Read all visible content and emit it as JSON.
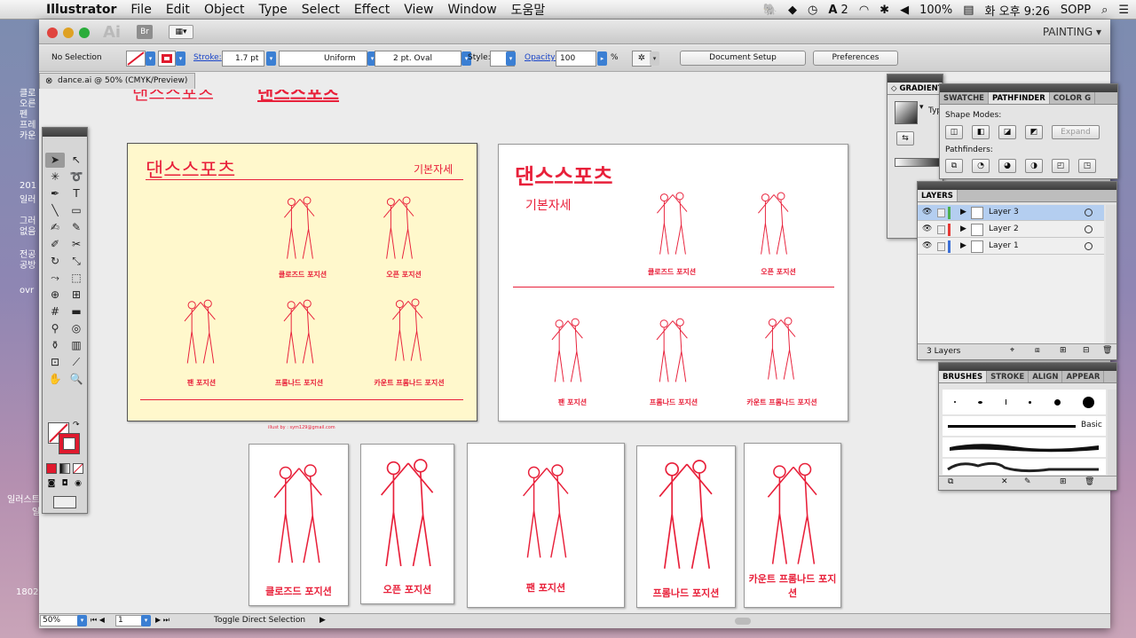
{
  "menubar": {
    "app": "Illustrator",
    "items": [
      "File",
      "Edit",
      "Object",
      "Type",
      "Select",
      "Effect",
      "View",
      "Window",
      "도움말"
    ],
    "right": {
      "ai_badge": "2",
      "battery": "100%",
      "clock": "화 오후 9:26",
      "user": "SOPP"
    }
  },
  "desktop_labels": [
    "클로",
    "오른",
    "펜",
    "프레",
    "카운",
    "201",
    "일러",
    "그러",
    "없음",
    "전공",
    "공방",
    "ovr",
    "일러스트",
    "일",
    "1802"
  ],
  "window": {
    "logo": "Ai",
    "bridge": "Br",
    "workspace": "PAINTING",
    "control": {
      "selection": "No Selection",
      "stroke_label": "Stroke:",
      "stroke_value": "1.7 pt",
      "profile": "Uniform",
      "brush": "2 pt. Oval",
      "style_label": "Style:",
      "opacity_label": "Opacity:",
      "opacity_value": "100",
      "opacity_unit": "%",
      "doc_setup": "Document Setup",
      "preferences": "Preferences"
    },
    "doc_tab": "dance.ai @ 50% (CMYK/Preview)"
  },
  "artwork": {
    "top_partial_left": "댄스스포츠",
    "top_partial_right": "댄스스포츠",
    "board1": {
      "title": "댄스스포츠",
      "subtitle": "기본자세",
      "captions": [
        "클로즈드 포지션",
        "오픈 포지션",
        "팬 포지션",
        "프롬나드 포지션",
        "카운트 프롬나드 포지션"
      ],
      "credit": "illust by : sym129@gmail.com"
    },
    "board2": {
      "title": "댄스스포츠",
      "subtitle": "기본자세",
      "captions": [
        "클로즈드 포지션",
        "오픈 포지션",
        "팬 포지션",
        "프롬나드 포지션",
        "카운트 프롬나드 포지션"
      ]
    },
    "cards": [
      "클로즈드 포지션",
      "오픈 포지션",
      "팬 포지션",
      "프롬나드 포지션",
      "카운트 프롬나드 포지션"
    ]
  },
  "status": {
    "zoom": "50%",
    "page": "1",
    "tool_hint": "Toggle Direct Selection"
  },
  "gradient_panel": {
    "tab": "GRADIENT",
    "type_label": "Typ"
  },
  "pathfinder_panel": {
    "tabs": [
      "SWATCHE",
      "PATHFINDER",
      "COLOR G"
    ],
    "shape_modes": "Shape Modes:",
    "pathfinders": "Pathfinders:",
    "expand": "Expand"
  },
  "layers_panel": {
    "tab": "LAYERS",
    "layers": [
      {
        "name": "Layer 3",
        "color": "#4caf50",
        "selected": true
      },
      {
        "name": "Layer 2",
        "color": "#e53935",
        "selected": false
      },
      {
        "name": "Layer 1",
        "color": "#3b6fd6",
        "selected": false
      }
    ],
    "count": "3 Layers"
  },
  "brushes_panel": {
    "tabs": [
      "BRUSHES",
      "STROKE",
      "ALIGN",
      "APPEAR"
    ],
    "basic_label": "Basic"
  },
  "colors": {
    "accent_red": "#e8203a",
    "board1_bg": "#fff8cc",
    "selection_blue": "#b4cef0"
  }
}
